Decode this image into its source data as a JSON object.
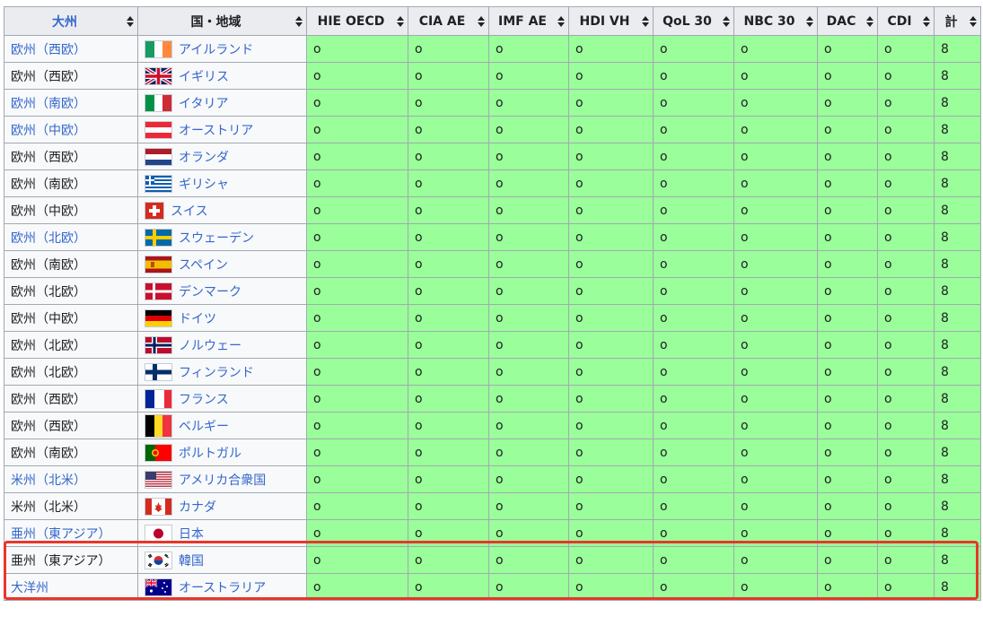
{
  "headers": [
    {
      "label": "大州",
      "link": true
    },
    {
      "label": "国・地域",
      "link": false
    },
    {
      "label": "HIE OECD",
      "link": false
    },
    {
      "label": "CIA AE",
      "link": false
    },
    {
      "label": "IMF AE",
      "link": false
    },
    {
      "label": "HDI VH",
      "link": false
    },
    {
      "label": "QoL 30",
      "link": false
    },
    {
      "label": "NBC 30",
      "link": false
    },
    {
      "label": "DAC",
      "link": false
    },
    {
      "label": "CDI",
      "link": false
    },
    {
      "label": "計",
      "link": false
    }
  ],
  "mark": "o",
  "rows": [
    {
      "continent": "欧州（西欧）",
      "continent_link": true,
      "country": "アイルランド",
      "country_link": true,
      "flag": "ireland-flag-icon",
      "total": "8"
    },
    {
      "continent": "欧州（西欧）",
      "continent_link": false,
      "country": "イギリス",
      "country_link": true,
      "flag": "uk-flag-icon",
      "total": "8"
    },
    {
      "continent": "欧州（南欧）",
      "continent_link": true,
      "country": "イタリア",
      "country_link": true,
      "flag": "italy-flag-icon",
      "total": "8"
    },
    {
      "continent": "欧州（中欧）",
      "continent_link": true,
      "country": "オーストリア",
      "country_link": true,
      "flag": "austria-flag-icon",
      "total": "8"
    },
    {
      "continent": "欧州（西欧）",
      "continent_link": false,
      "country": "オランダ",
      "country_link": true,
      "flag": "netherlands-flag-icon",
      "total": "8"
    },
    {
      "continent": "欧州（南欧）",
      "continent_link": false,
      "country": "ギリシャ",
      "country_link": true,
      "flag": "greece-flag-icon",
      "total": "8"
    },
    {
      "continent": "欧州（中欧）",
      "continent_link": false,
      "country": "スイス",
      "country_link": true,
      "flag": "switzerland-flag-icon",
      "total": "8",
      "tall": true
    },
    {
      "continent": "欧州（北欧）",
      "continent_link": true,
      "country": "スウェーデン",
      "country_link": true,
      "flag": "sweden-flag-icon",
      "total": "8"
    },
    {
      "continent": "欧州（南欧）",
      "continent_link": false,
      "country": "スペイン",
      "country_link": true,
      "flag": "spain-flag-icon",
      "total": "8"
    },
    {
      "continent": "欧州（北欧）",
      "continent_link": false,
      "country": "デンマーク",
      "country_link": true,
      "flag": "denmark-flag-icon",
      "total": "8"
    },
    {
      "continent": "欧州（中欧）",
      "continent_link": false,
      "country": "ドイツ",
      "country_link": true,
      "flag": "germany-flag-icon",
      "total": "8"
    },
    {
      "continent": "欧州（北欧）",
      "continent_link": false,
      "country": "ノルウェー",
      "country_link": true,
      "flag": "norway-flag-icon",
      "total": "8"
    },
    {
      "continent": "欧州（北欧）",
      "continent_link": false,
      "country": "フィンランド",
      "country_link": true,
      "flag": "finland-flag-icon",
      "total": "8"
    },
    {
      "continent": "欧州（西欧）",
      "continent_link": false,
      "country": "フランス",
      "country_link": true,
      "flag": "france-flag-icon",
      "total": "8"
    },
    {
      "continent": "欧州（西欧）",
      "continent_link": false,
      "country": "ベルギー",
      "country_link": true,
      "flag": "belgium-flag-icon",
      "total": "8",
      "tall": true
    },
    {
      "continent": "欧州（南欧）",
      "continent_link": false,
      "country": "ポルトガル",
      "country_link": true,
      "flag": "portugal-flag-icon",
      "total": "8"
    },
    {
      "continent": "米州（北米）",
      "continent_link": true,
      "country": "アメリカ合衆国",
      "country_link": true,
      "flag": "usa-flag-icon",
      "total": "8"
    },
    {
      "continent": "米州（北米）",
      "continent_link": false,
      "country": "カナダ",
      "country_link": true,
      "flag": "canada-flag-icon",
      "total": "8"
    },
    {
      "continent": "亜州（東アジア）",
      "continent_link": true,
      "country": "日本",
      "country_link": true,
      "flag": "japan-flag-icon",
      "total": "8"
    },
    {
      "continent": "亜州（東アジア）",
      "continent_link": false,
      "country": "韓国",
      "country_link": true,
      "flag": "south-korea-flag-icon",
      "total": "8"
    },
    {
      "continent": "大洋州",
      "continent_link": true,
      "country": "オーストラリア",
      "country_link": true,
      "flag": "australia-flag-icon",
      "total": "8"
    }
  ],
  "colors": {
    "header_bg": "#eaecf0",
    "cell_green": "#9aff9a",
    "link": "#3366cc",
    "highlight": "#e8362a",
    "border": "#a2a9b1"
  }
}
